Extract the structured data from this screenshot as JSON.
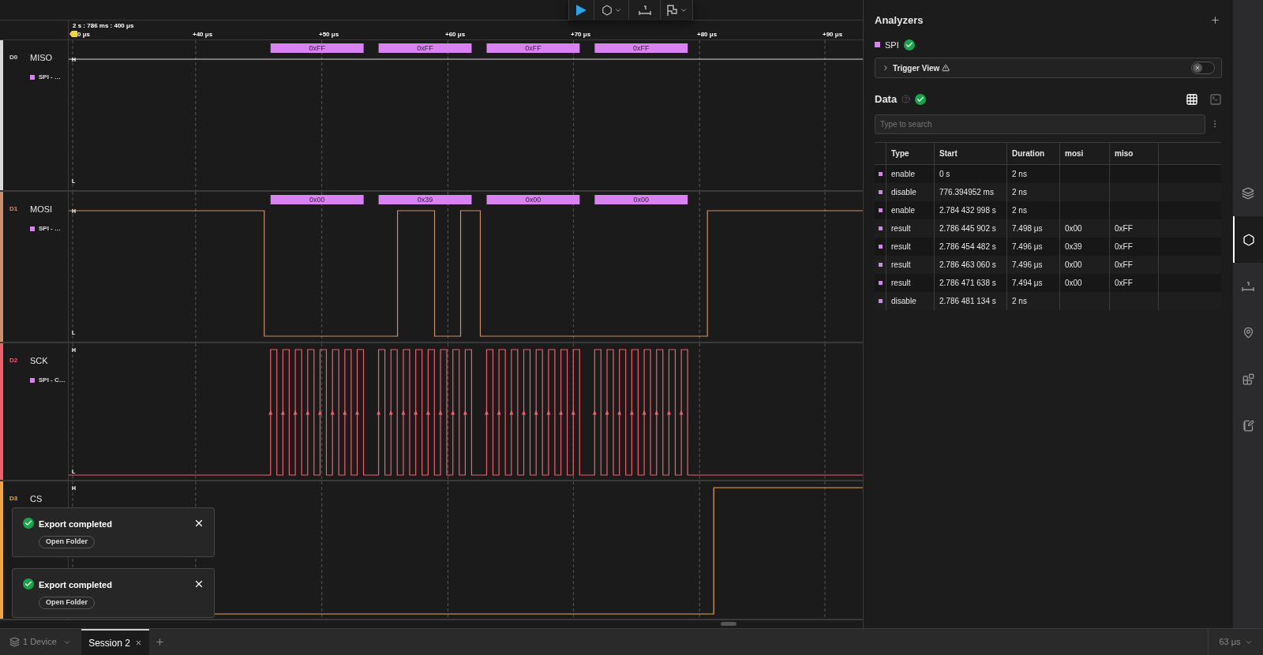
{
  "ruler": {
    "origin": "2 s : 786 ms : 400 μs",
    "ticks": [
      "0 μs",
      "+40 μs",
      "+50 μs",
      "+60 μs",
      "+70 μs",
      "+80 μs",
      "+90 μs"
    ]
  },
  "channels": [
    {
      "id": "D0",
      "name": "MISO",
      "color": "#d9d9d9",
      "analyzer": {
        "label": "SPI - …",
        "color": "#d982f2"
      },
      "levels": [
        "H",
        "L"
      ],
      "frames": [
        "0xFF",
        "0xFF",
        "0xFF",
        "0xFF"
      ]
    },
    {
      "id": "D1",
      "name": "MOSI",
      "color": "#c98f70",
      "analyzer": {
        "label": "SPI - …",
        "color": "#d982f2"
      },
      "levels": [
        "H",
        "L"
      ],
      "frames": [
        "0x00",
        "0x39",
        "0x00",
        "0x00"
      ]
    },
    {
      "id": "D2",
      "name": "SCK",
      "color": "#ef5f6e",
      "analyzer": {
        "label": "SPI - C…",
        "color": "#d982f2"
      },
      "levels": [
        "H",
        "L"
      ]
    },
    {
      "id": "D3",
      "name": "CS",
      "color": "#f2a541",
      "levels": [
        "H"
      ]
    }
  ],
  "toasts": [
    {
      "title": "Export completed",
      "action": "Open Folder"
    },
    {
      "title": "Export completed",
      "action": "Open Folder"
    }
  ],
  "analyzers": {
    "title": "Analyzers",
    "items": [
      {
        "name": "SPI",
        "color": "#d982f2",
        "ok": true
      }
    ],
    "trigger_view": {
      "label": "Trigger View",
      "on": false
    }
  },
  "data": {
    "title": "Data",
    "ok": true,
    "views": [
      {
        "kind": "table",
        "selected": true
      },
      {
        "kind": "terminal",
        "selected": false
      }
    ],
    "search": {
      "placeholder": "Type to search"
    },
    "table": {
      "columns": [
        "Type",
        "Start",
        "Duration",
        "mosi",
        "miso"
      ],
      "rows": [
        {
          "color": "#d982f2",
          "cells": [
            "enable",
            "0 s",
            "2 ns"
          ]
        },
        {
          "color": "#d982f2",
          "cells": [
            "disable",
            "776.394952 ms",
            "2 ns"
          ]
        },
        {
          "color": "#d982f2",
          "cells": [
            "enable",
            "2.784 432 998 s",
            "2 ns"
          ]
        },
        {
          "color": "#d982f2",
          "cells": [
            "result",
            "2.786 445 902 s",
            "7.498 μs",
            "0x00",
            "0xFF"
          ]
        },
        {
          "color": "#d982f2",
          "cells": [
            "result",
            "2.786 454 482 s",
            "7.496 μs",
            "0x39",
            "0xFF"
          ]
        },
        {
          "color": "#d982f2",
          "cells": [
            "result",
            "2.786 463 060 s",
            "7.496 μs",
            "0x00",
            "0xFF"
          ]
        },
        {
          "color": "#d982f2",
          "cells": [
            "result",
            "2.786 471 638 s",
            "7.494 μs",
            "0x00",
            "0xFF"
          ]
        },
        {
          "color": "#d982f2",
          "cells": [
            "disable",
            "2.786 481 134 s",
            "2 ns"
          ]
        }
      ]
    }
  },
  "rail": [
    {
      "kind": "device",
      "selected": false
    },
    {
      "kind": "analyzers",
      "selected": true
    },
    {
      "kind": "measure",
      "selected": false
    },
    {
      "kind": "marker",
      "selected": false
    },
    {
      "kind": "extension",
      "selected": false
    },
    {
      "kind": "notes",
      "selected": false
    }
  ],
  "bottom": {
    "device": "1 Device",
    "tabs": [
      {
        "label": "Session 2",
        "selected": true
      }
    ],
    "zoom": "63 μs"
  }
}
